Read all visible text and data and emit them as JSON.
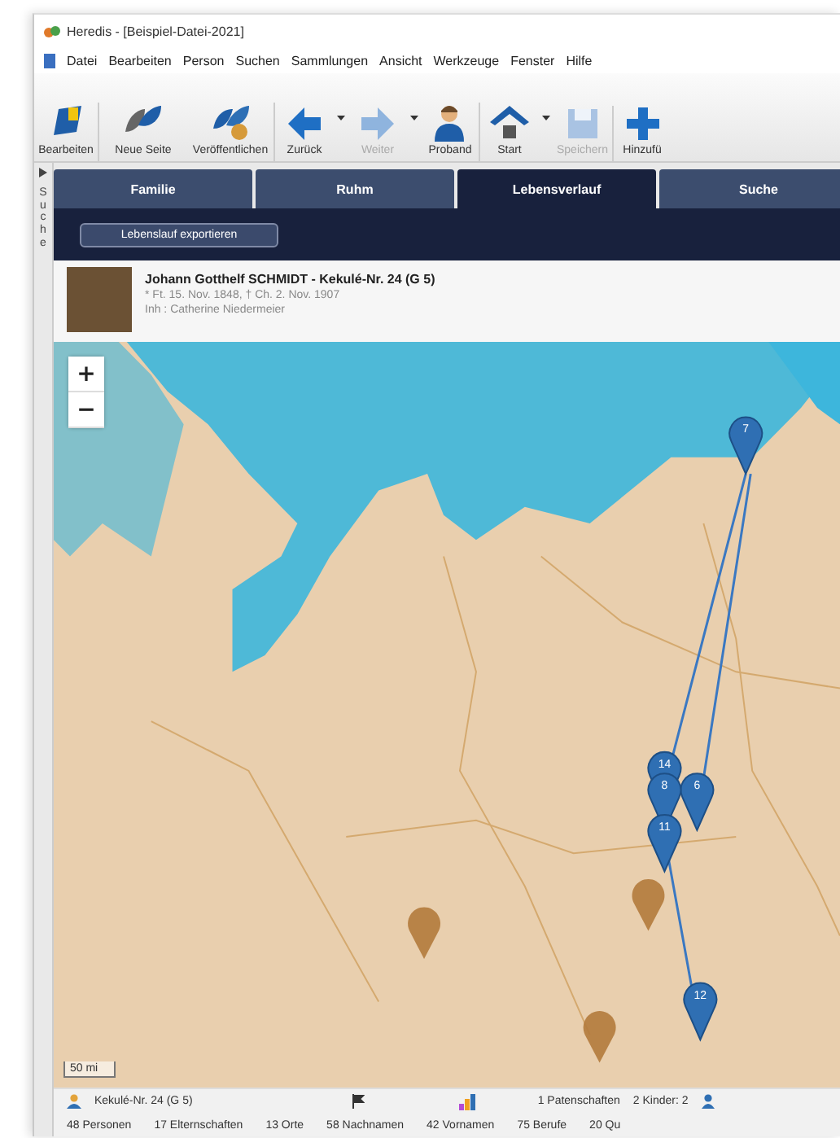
{
  "window": {
    "title": "Heredis - [Beispiel-Datei-2021]"
  },
  "menu": [
    "Datei",
    "Bearbeiten",
    "Person",
    "Suchen",
    "Sammlungen",
    "Ansicht",
    "Werkzeuge",
    "Fenster",
    "Hilfe"
  ],
  "toolbar": [
    {
      "label": "Bearbeiten",
      "disabled": false,
      "dropdown": false
    },
    {
      "label": "Neue Seite",
      "disabled": false,
      "dropdown": false
    },
    {
      "label": "Veröffentlichen",
      "disabled": false,
      "dropdown": false
    },
    {
      "label": "Zurück",
      "disabled": false,
      "dropdown": true
    },
    {
      "label": "Weiter",
      "disabled": true,
      "dropdown": true
    },
    {
      "label": "Proband",
      "disabled": false,
      "dropdown": false
    },
    {
      "label": "Start",
      "disabled": false,
      "dropdown": true
    },
    {
      "label": "Speichern",
      "disabled": true,
      "dropdown": false
    },
    {
      "label": "Hinzufü",
      "disabled": false,
      "dropdown": false
    }
  ],
  "side_strip": {
    "label": "Suche"
  },
  "tabs": [
    {
      "label": "Familie",
      "selected": false
    },
    {
      "label": "Ruhm",
      "selected": false
    },
    {
      "label": "Lebensverlauf",
      "selected": true
    },
    {
      "label": "Suche",
      "selected": false
    }
  ],
  "action_button": "Lebenslauf exportieren",
  "person": {
    "name": "Johann Gotthelf SCHMIDT - Kekulé-Nr. 24 (G 5)",
    "dates": "* Ft. 15. Nov. 1848, † Ch. 2. Nov. 1907",
    "spouse": "Inh : Catherine Niedermeier"
  },
  "map": {
    "zoom_in": "+",
    "zoom_out": "−",
    "scale": "50 mi",
    "markers": [
      {
        "kind": "numbered",
        "label": "7"
      },
      {
        "kind": "numbered",
        "label": "6"
      },
      {
        "kind": "numbered",
        "label": "14"
      },
      {
        "kind": "numbered",
        "label": "8"
      },
      {
        "kind": "numbered",
        "label": "11"
      },
      {
        "kind": "numbered",
        "label": "12"
      },
      {
        "kind": "plain"
      },
      {
        "kind": "plain"
      },
      {
        "kind": "plain"
      }
    ]
  },
  "status_bar": {
    "kekule": "Kekulé-Nr. 24 (G 5)",
    "relations": "1 Patenschaften",
    "children": "2 Kinder: 2",
    "counts": [
      "48 Personen",
      "17 Elternschaften",
      "13 Orte",
      "58 Nachnamen",
      "42 Vornamen",
      "75 Berufe",
      "20 Qu"
    ]
  }
}
